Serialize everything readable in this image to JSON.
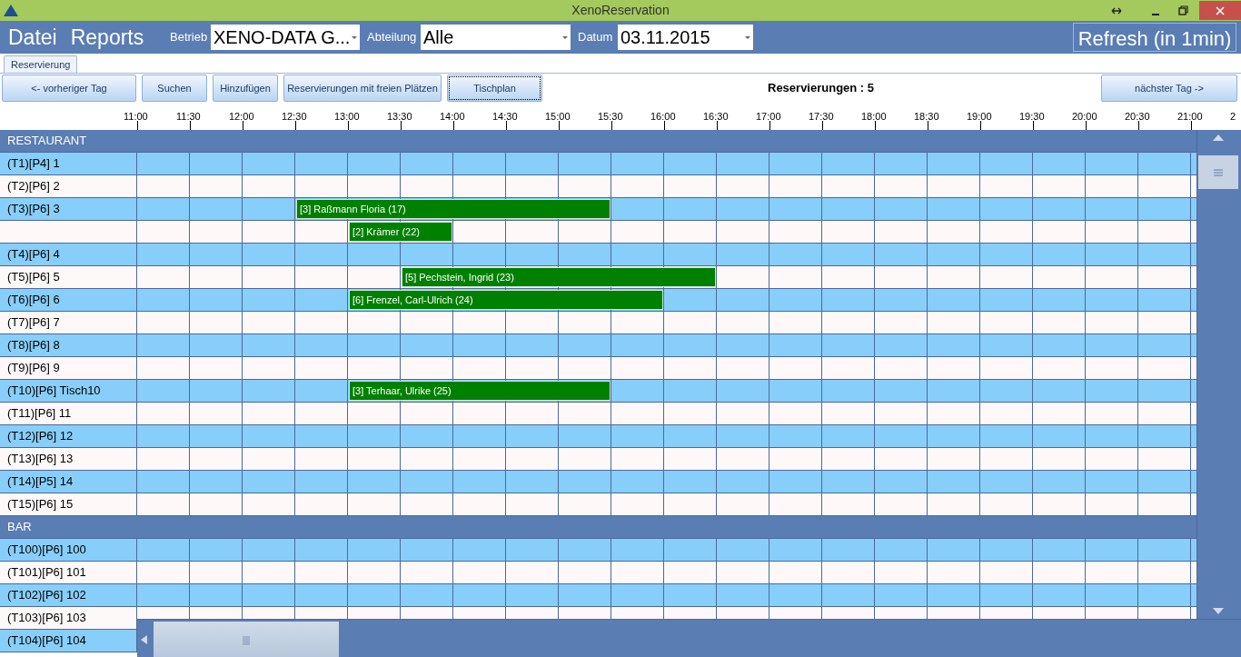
{
  "window": {
    "title": "XenoReservation"
  },
  "menu": [
    "Datei",
    "Reports"
  ],
  "filters": [
    {
      "label": "Betrieb",
      "value": "XENO-DATA G..."
    },
    {
      "label": "Abteilung",
      "value": "Alle"
    },
    {
      "label": "Datum",
      "value": "03.11.2015"
    }
  ],
  "refresh_button": "Refresh (in 1min)",
  "tabs": [
    {
      "label": "Reservierung",
      "selected": true
    }
  ],
  "toolbar_buttons": [
    {
      "label": "<- vorheriger Tag",
      "focused": false
    },
    {
      "label": "Suchen",
      "focused": false
    },
    {
      "label": "Hinzufügen",
      "focused": false
    },
    {
      "label": "Reservierungen mit freien Plätzen",
      "focused": false
    },
    {
      "label": "Tischplan",
      "focused": true
    }
  ],
  "reservation_count": "Reservierungen : 5",
  "next_button": "nächster Tag ->",
  "time_axis": [
    "11:00",
    "11:30",
    "12:00",
    "12:30",
    "13:00",
    "13:30",
    "14:00",
    "14:30",
    "15:00",
    "15:30",
    "16:00",
    "16:30",
    "17:00",
    "17:30",
    "18:00",
    "18:30",
    "19:00",
    "19:30",
    "20:00",
    "20:30",
    "21:00",
    "2"
  ],
  "rows": [
    {
      "kind": "section",
      "label": "RESTAURANT"
    },
    {
      "kind": "table",
      "label": "(T1)[P4] 1",
      "reservations": []
    },
    {
      "kind": "table",
      "label": "(T2)[P6] 2",
      "reservations": []
    },
    {
      "kind": "table",
      "label": "(T3)[P6] 3",
      "reservations": [
        {
          "label": "[3] Raßmann Floria (17)"
        }
      ]
    },
    {
      "kind": "table",
      "reservations": [
        {
          "label": "[2] Krämer (22)"
        }
      ]
    },
    {
      "kind": "table",
      "label": "(T4)[P6] 4",
      "reservations": []
    },
    {
      "kind": "table",
      "label": "(T5)[P6] 5",
      "reservations": [
        {
          "label": "[5] Pechstein, Ingrid (23)"
        }
      ]
    },
    {
      "kind": "table",
      "label": "(T6)[P6] 6",
      "reservations": [
        {
          "label": "[6] Frenzel, Carl-Ulrich (24)"
        }
      ]
    },
    {
      "kind": "table",
      "label": "(T7)[P6] 7",
      "reservations": []
    },
    {
      "kind": "table",
      "label": "(T8)[P6] 8",
      "reservations": []
    },
    {
      "kind": "table",
      "label": "(T9)[P6] 9",
      "reservations": []
    },
    {
      "kind": "table",
      "label": "(T10)[P6] Tisch10",
      "reservations": [
        {
          "label": "[3] Terhaar, Ulrike (25)"
        }
      ]
    },
    {
      "kind": "table",
      "label": "(T11)[P6] 11",
      "reservations": []
    },
    {
      "kind": "table",
      "label": "(T12)[P6] 12",
      "reservations": []
    },
    {
      "kind": "table",
      "label": "(T13)[P6] 13",
      "reservations": []
    },
    {
      "kind": "table",
      "label": "(T14)[P5] 14",
      "reservations": []
    },
    {
      "kind": "table",
      "label": "(T15)[P6] 15",
      "reservations": []
    },
    {
      "kind": "section",
      "label": "BAR"
    },
    {
      "kind": "table",
      "label": "(T100)[P6] 100",
      "reservations": []
    },
    {
      "kind": "table",
      "label": "(T101)[P6] 101",
      "reservations": []
    },
    {
      "kind": "table",
      "label": "(T102)[P6] 102",
      "reservations": []
    },
    {
      "kind": "table",
      "label": "(T103)[P6] 103",
      "reservations": []
    },
    {
      "kind": "table",
      "label": "(T104)[P6] 104",
      "reservations": []
    }
  ]
}
